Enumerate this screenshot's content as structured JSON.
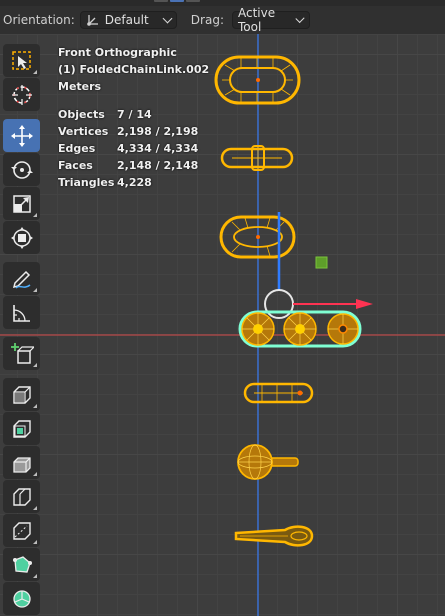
{
  "header": {
    "orientation_label": "Orientation:",
    "orientation_value": "Default",
    "drag_label": "Drag:",
    "drag_value": "Active Tool"
  },
  "overlay": {
    "view_name": "Front Orthographic",
    "active_object": "(1) FoldedChainLink.002",
    "units": "Meters",
    "stats": [
      {
        "label": "Objects",
        "value": "7 / 14"
      },
      {
        "label": "Vertices",
        "value": "2,198 / 2,198"
      },
      {
        "label": "Edges",
        "value": "4,334 / 4,334"
      },
      {
        "label": "Faces",
        "value": "2,148 / 2,148"
      },
      {
        "label": "Triangles",
        "value": "4,228"
      }
    ]
  },
  "toolbar": {
    "active_tool": "move",
    "tools": [
      "select-box",
      "cursor",
      "move",
      "rotate",
      "scale",
      "transform",
      "annotate",
      "measure",
      "add-cube",
      "extrude-region",
      "inset-faces",
      "bevel",
      "loop-cut",
      "knife",
      "poly-build",
      "spin"
    ]
  },
  "colors": {
    "selected": "#ffb700",
    "active_outline": "#7fffd4",
    "x_axis": "#b84a4a",
    "z_axis": "#3a6fd0",
    "gizmo_x": "#ff3352",
    "accent": "#4772b3"
  }
}
